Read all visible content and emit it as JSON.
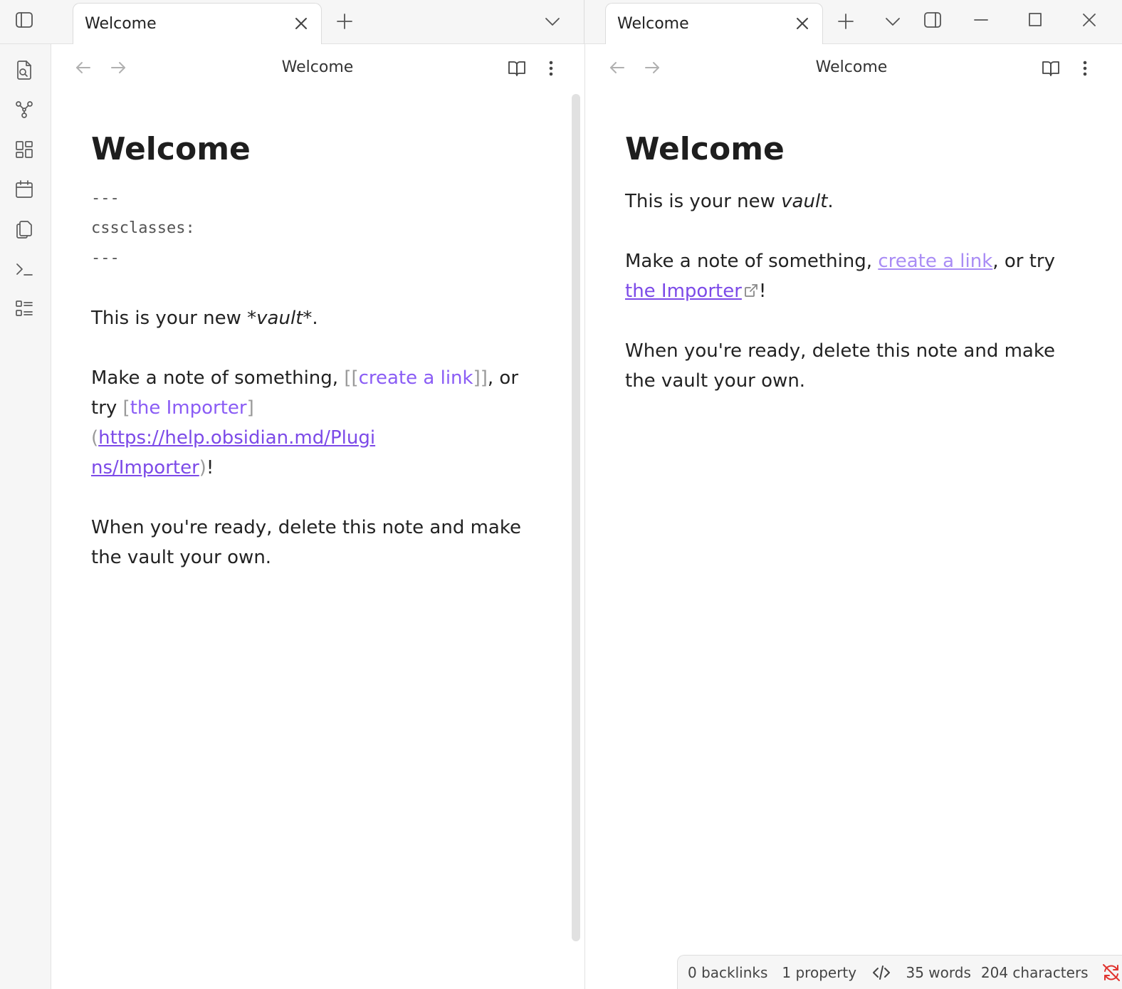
{
  "tabs": {
    "left": {
      "title": "Welcome"
    },
    "right": {
      "title": "Welcome"
    }
  },
  "left_pane": {
    "header_title": "Welcome",
    "heading": "Welcome",
    "frontmatter": {
      "open": "---",
      "key": "cssclasses:",
      "close": "---"
    },
    "p1": {
      "before": "This is your new ",
      "emph": "*vault*",
      "after": "."
    },
    "p2": {
      "before": "Make a note of something, ",
      "wl_open": "[[",
      "wl_text": "create a link",
      "wl_close": "]]",
      "mid": ", or",
      "line2_start": "try ",
      "ml_open": "[",
      "ml_text": "the Importer",
      "ml_close_paren_open": "](",
      "url_part1": "https://help.obsidian.md/Plugi",
      "url_part2": "ns/Importer",
      "paren_close": ")",
      "end": "!"
    },
    "p3": {
      "line1": "When you're ready, delete this note and make",
      "line2": "the vault your own."
    }
  },
  "right_pane": {
    "header_title": "Welcome",
    "heading": "Welcome",
    "p1": {
      "before": "This is your new ",
      "emph": "vault",
      "after": "."
    },
    "p2": {
      "before": "Make a note of something, ",
      "link1": "create a link",
      "mid": ", or try",
      "link2": "the Importer",
      "end": "!"
    },
    "p3": {
      "line1": "When you're ready, delete this note and make",
      "line2": "the vault your own."
    }
  },
  "status_bar": {
    "backlinks": "0 backlinks",
    "properties": "1 property",
    "words": "35 words",
    "characters": "204 characters"
  },
  "colors": {
    "accent": "#8a5cf5",
    "sync_error": "#e0342f"
  },
  "icons": {
    "ribbon": [
      "search-file-icon",
      "graph-icon",
      "canvas-icon",
      "calendar-icon",
      "copy-files-icon",
      "terminal-icon",
      "list-icon"
    ]
  }
}
